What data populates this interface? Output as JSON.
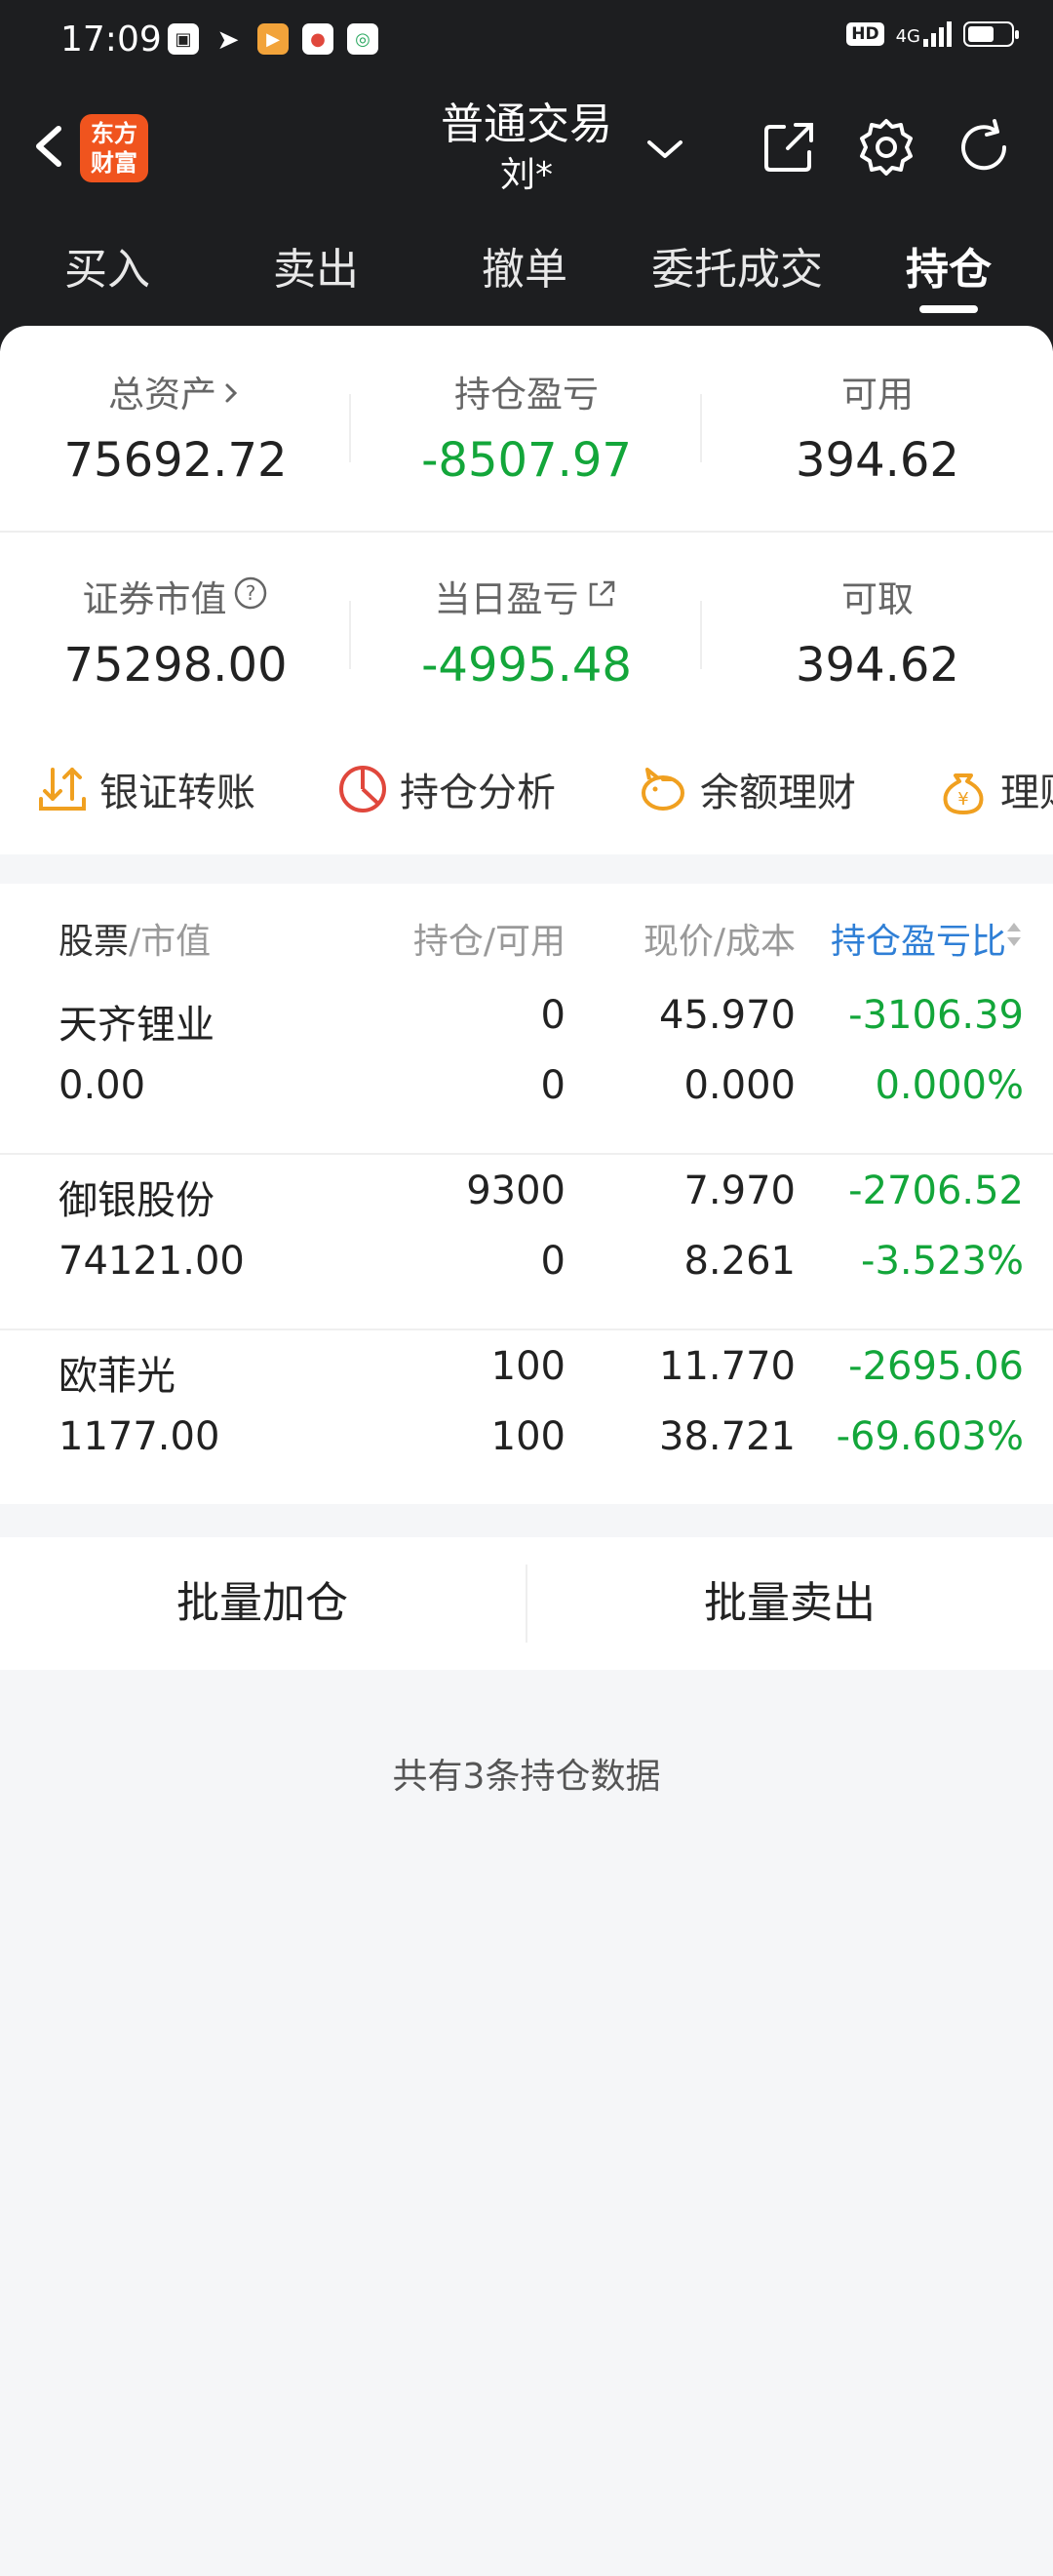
{
  "status": {
    "time": "17:09",
    "hd": "HD",
    "network": "4G"
  },
  "header": {
    "logo_line1": "东方",
    "logo_line2": "财富",
    "title": "普通交易",
    "subtitle": "刘*"
  },
  "tabs": [
    {
      "label": "买入"
    },
    {
      "label": "卖出"
    },
    {
      "label": "撤单"
    },
    {
      "label": "委托成交"
    },
    {
      "label": "持仓"
    }
  ],
  "summary": {
    "total_assets_label": "总资产",
    "total_assets": "75692.72",
    "position_pl_label": "持仓盈亏",
    "position_pl": "-8507.97",
    "available_label": "可用",
    "available": "394.62",
    "market_value_label": "证券市值",
    "market_value": "75298.00",
    "daily_pl_label": "当日盈亏",
    "daily_pl": "-4995.48",
    "withdrawable_label": "可取",
    "withdrawable": "394.62"
  },
  "quick_actions": [
    {
      "label": "银证转账",
      "icon": "transfer-icon"
    },
    {
      "label": "持仓分析",
      "icon": "pie-chart-icon"
    },
    {
      "label": "余额理财",
      "icon": "piggy-bank-icon"
    },
    {
      "label": "理财",
      "icon": "money-bag-icon"
    }
  ],
  "table": {
    "col_stock": "股票",
    "col_stock_sub": "/市值",
    "col_position": "持仓/可用",
    "col_price": "现价/成本",
    "col_pl": "持仓盈亏比",
    "rows": [
      {
        "name": "天齐锂业",
        "market_value": "0.00",
        "position": "0",
        "available": "0",
        "price": "45.970",
        "cost": "0.000",
        "pl": "-3106.39",
        "pl_ratio": "0.000%"
      },
      {
        "name": "御银股份",
        "market_value": "74121.00",
        "position": "9300",
        "available": "0",
        "price": "7.970",
        "cost": "8.261",
        "pl": "-2706.52",
        "pl_ratio": "-3.523%"
      },
      {
        "name": "欧菲光",
        "market_value": "1177.00",
        "position": "100",
        "available": "100",
        "price": "11.770",
        "cost": "38.721",
        "pl": "-2695.06",
        "pl_ratio": "-69.603%"
      }
    ]
  },
  "buttons": {
    "batch_add": "批量加仓",
    "batch_sell": "批量卖出"
  },
  "footer": "共有3条持仓数据",
  "colors": {
    "header_bg": "#1d1e20",
    "loss_green": "#13a63a",
    "accent_blue": "#2f7fd6",
    "logo_orange": "#f0541e",
    "icon_orange": "#f0a020",
    "icon_red": "#e0473c"
  }
}
